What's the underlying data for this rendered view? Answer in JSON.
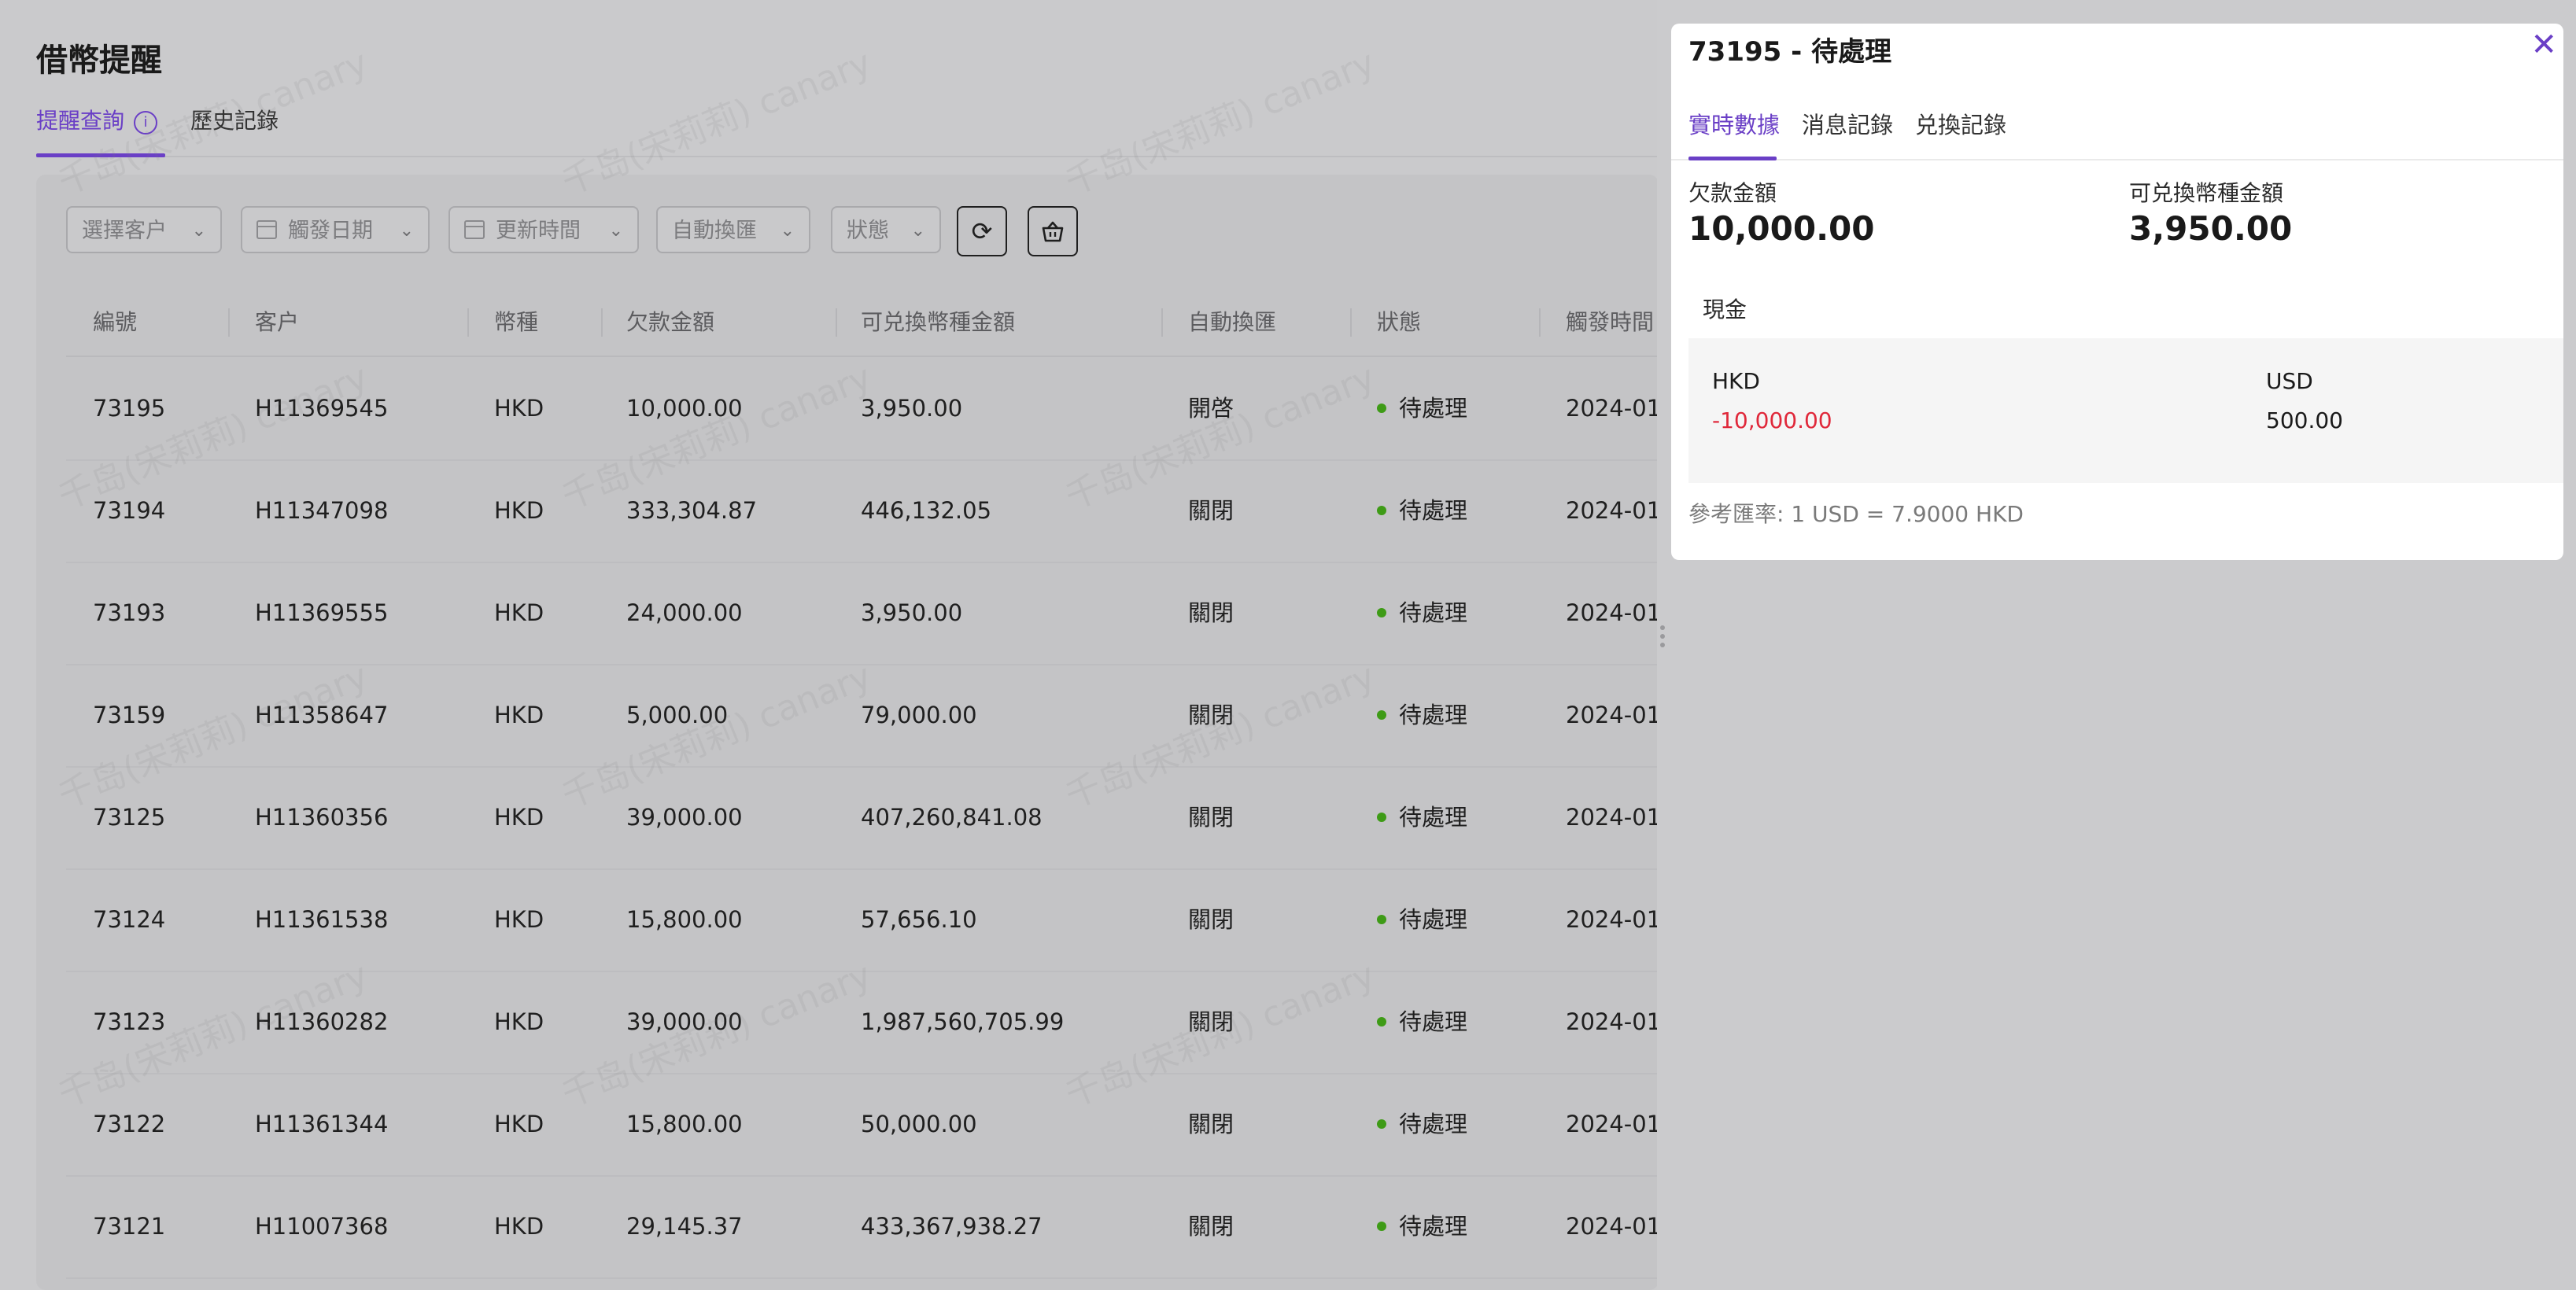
{
  "page": {
    "title": "借幣提醒",
    "tabs": [
      {
        "label": "提醒查詢",
        "active": true,
        "info_icon": "info-icon"
      },
      {
        "label": "歷史記錄",
        "active": false
      }
    ]
  },
  "filters": {
    "customer": "選擇客户",
    "trigger_date": "觸發日期",
    "update_time": "更新時間",
    "auto_exchange": "自動換匯",
    "status": "狀態",
    "refresh_icon": "refresh-icon",
    "basket_icon": "basket-icon"
  },
  "table": {
    "columns": [
      "編號",
      "客户",
      "幣種",
      "欠款金額",
      "可兑換幣種金額",
      "自動換匯",
      "狀態",
      "觸發時間"
    ],
    "rows": [
      {
        "id": "73195",
        "customer": "H11369545",
        "currency": "HKD",
        "owed": "10,000.00",
        "exchangeable": "3,950.00",
        "auto": "開啓",
        "status": "待處理",
        "time": "2024-01"
      },
      {
        "id": "73194",
        "customer": "H11347098",
        "currency": "HKD",
        "owed": "333,304.87",
        "exchangeable": "446,132.05",
        "auto": "關閉",
        "status": "待處理",
        "time": "2024-01"
      },
      {
        "id": "73193",
        "customer": "H11369555",
        "currency": "HKD",
        "owed": "24,000.00",
        "exchangeable": "3,950.00",
        "auto": "關閉",
        "status": "待處理",
        "time": "2024-01"
      },
      {
        "id": "73159",
        "customer": "H11358647",
        "currency": "HKD",
        "owed": "5,000.00",
        "exchangeable": "79,000.00",
        "auto": "關閉",
        "status": "待處理",
        "time": "2024-01"
      },
      {
        "id": "73125",
        "customer": "H11360356",
        "currency": "HKD",
        "owed": "39,000.00",
        "exchangeable": "407,260,841.08",
        "auto": "關閉",
        "status": "待處理",
        "time": "2024-01"
      },
      {
        "id": "73124",
        "customer": "H11361538",
        "currency": "HKD",
        "owed": "15,800.00",
        "exchangeable": "57,656.10",
        "auto": "關閉",
        "status": "待處理",
        "time": "2024-01"
      },
      {
        "id": "73123",
        "customer": "H11360282",
        "currency": "HKD",
        "owed": "39,000.00",
        "exchangeable": "1,987,560,705.99",
        "auto": "關閉",
        "status": "待處理",
        "time": "2024-01"
      },
      {
        "id": "73122",
        "customer": "H11361344",
        "currency": "HKD",
        "owed": "15,800.00",
        "exchangeable": "50,000.00",
        "auto": "關閉",
        "status": "待處理",
        "time": "2024-01"
      },
      {
        "id": "73121",
        "customer": "H11007368",
        "currency": "HKD",
        "owed": "29,145.37",
        "exchangeable": "433,367,938.27",
        "auto": "關閉",
        "status": "待處理",
        "time": "2024-01"
      }
    ],
    "status_color": "#3e9b16"
  },
  "watermark": "千岛(宋莉莉) canary",
  "drawer": {
    "title": "73195 - 待處理",
    "close_icon": "close-icon",
    "tabs": [
      {
        "label": "實時數據",
        "active": true
      },
      {
        "label": "消息記錄",
        "active": false
      },
      {
        "label": "兑換記錄",
        "active": false
      }
    ],
    "owed_label": "欠款金額",
    "owed_value": "10,000.00",
    "exchangeable_label": "可兑換幣種金額",
    "exchangeable_value": "3,950.00",
    "cash_label": "現金",
    "cash": [
      {
        "currency": "HKD",
        "amount": "-10,000.00",
        "negative": true
      },
      {
        "currency": "USD",
        "amount": "500.00",
        "negative": false
      }
    ],
    "rate_text": "參考匯率:  1 USD = 7.9000 HKD"
  },
  "colors": {
    "accent": "#6a3fc6",
    "negative": "#e0283a",
    "status_dot": "#3e9b16"
  }
}
